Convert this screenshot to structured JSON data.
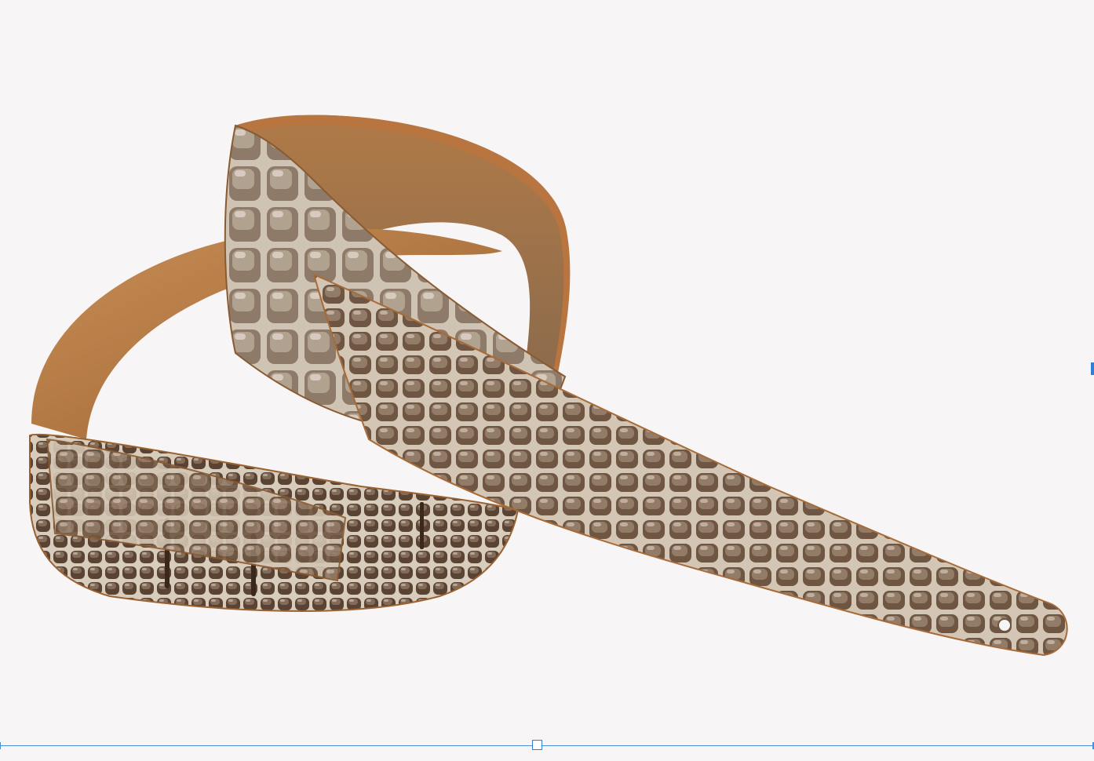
{
  "image": {
    "subject": "guitar-strap",
    "background_color": "#f7f5f6",
    "colors": {
      "leather_tan": "#c98e56",
      "leather_tan_dark": "#9b6231",
      "croc_dark": "#4a3526",
      "croc_mid": "#7a6350",
      "croc_highlight": "#d8ccbc",
      "edge": "#b8753f"
    }
  },
  "selection": {
    "accent_color": "#2f7fd6",
    "handles": [
      "bottom-center-handle",
      "right-edge-handle"
    ]
  }
}
